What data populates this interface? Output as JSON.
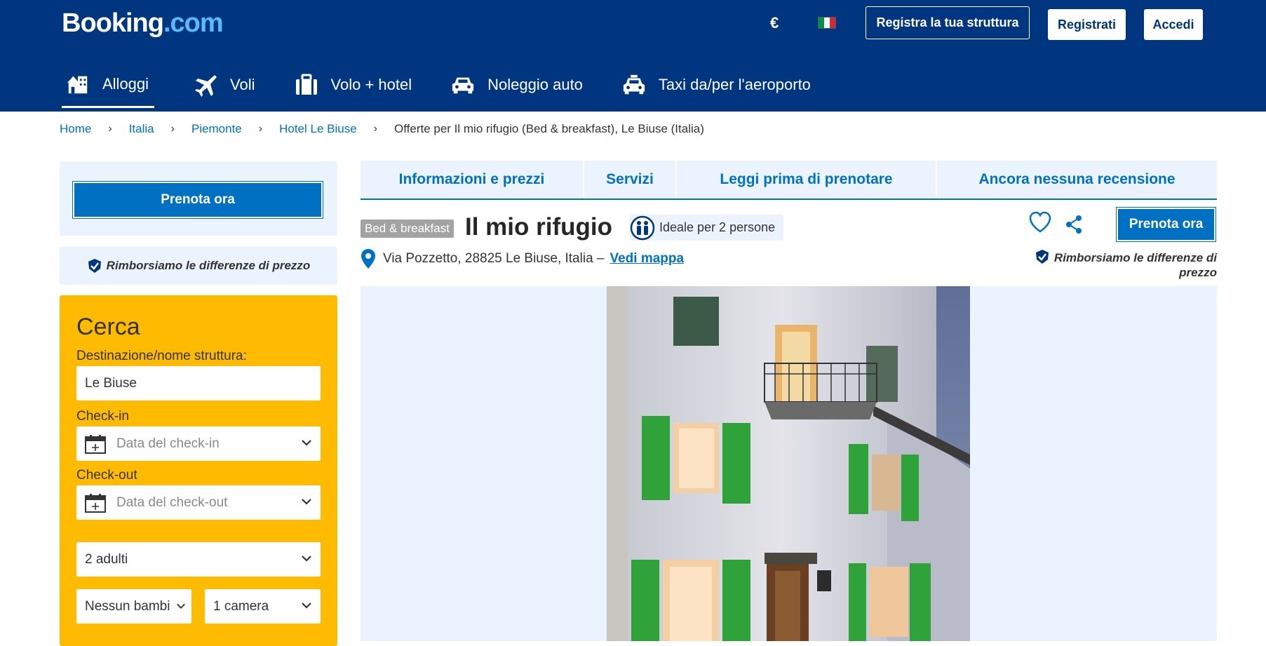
{
  "header": {
    "logo_main": "Booking",
    "logo_dot": ".com",
    "currency": "€",
    "flag_colors": [
      "#009246",
      "#ffffff",
      "#ce2b37"
    ],
    "list_property": "Registra la tua struttura",
    "register": "Registrati",
    "login": "Accedi"
  },
  "nav": {
    "items": [
      {
        "label": "Alloggi",
        "icon": "hotel-icon"
      },
      {
        "label": "Voli",
        "icon": "plane-icon"
      },
      {
        "label": "Volo + hotel",
        "icon": "suitcase-icon"
      },
      {
        "label": "Noleggio auto",
        "icon": "car-icon"
      },
      {
        "label": "Taxi da/per l'aeroporto",
        "icon": "taxi-icon"
      }
    ]
  },
  "breadcrumb": {
    "items": [
      "Home",
      "Italia",
      "Piemonte",
      "Hotel Le Biuse"
    ],
    "current": "Offerte per Il mio rifugio (Bed & breakfast), Le Biuse (Italia)"
  },
  "sidebar": {
    "book_now": "Prenota ora",
    "refund": "Rimborsiamo le differenze di prezzo",
    "search": {
      "title": "Cerca",
      "destination_label": "Destinazione/nome struttura:",
      "destination_value": "Le Biuse",
      "checkin_label": "Check-in",
      "checkin_placeholder": "Data del check-in",
      "checkout_label": "Check-out",
      "checkout_placeholder": "Data del check-out",
      "adults": "2 adulti",
      "children": "Nessun bambino",
      "rooms": "1 camera"
    }
  },
  "tabs": [
    "Informazioni e prezzi",
    "Servizi",
    "Leggi prima di prenotare",
    "Ancora nessuna recensione"
  ],
  "property": {
    "type_badge": "Bed & breakfast",
    "name": "Il mio rifugio",
    "ideal_for": "Ideale per 2 persone",
    "address": "Via Pozzetto, 28825 Le Biuse, Italia –",
    "map_link": "Vedi mappa",
    "book_now": "Prenota ora",
    "refund": "Rimborsiamo le differenze di prezzo"
  },
  "colors": {
    "brand_navy": "#003580",
    "brand_blue": "#0071c2",
    "search_yellow": "#febb02",
    "light_blue": "#ebf3ff"
  }
}
